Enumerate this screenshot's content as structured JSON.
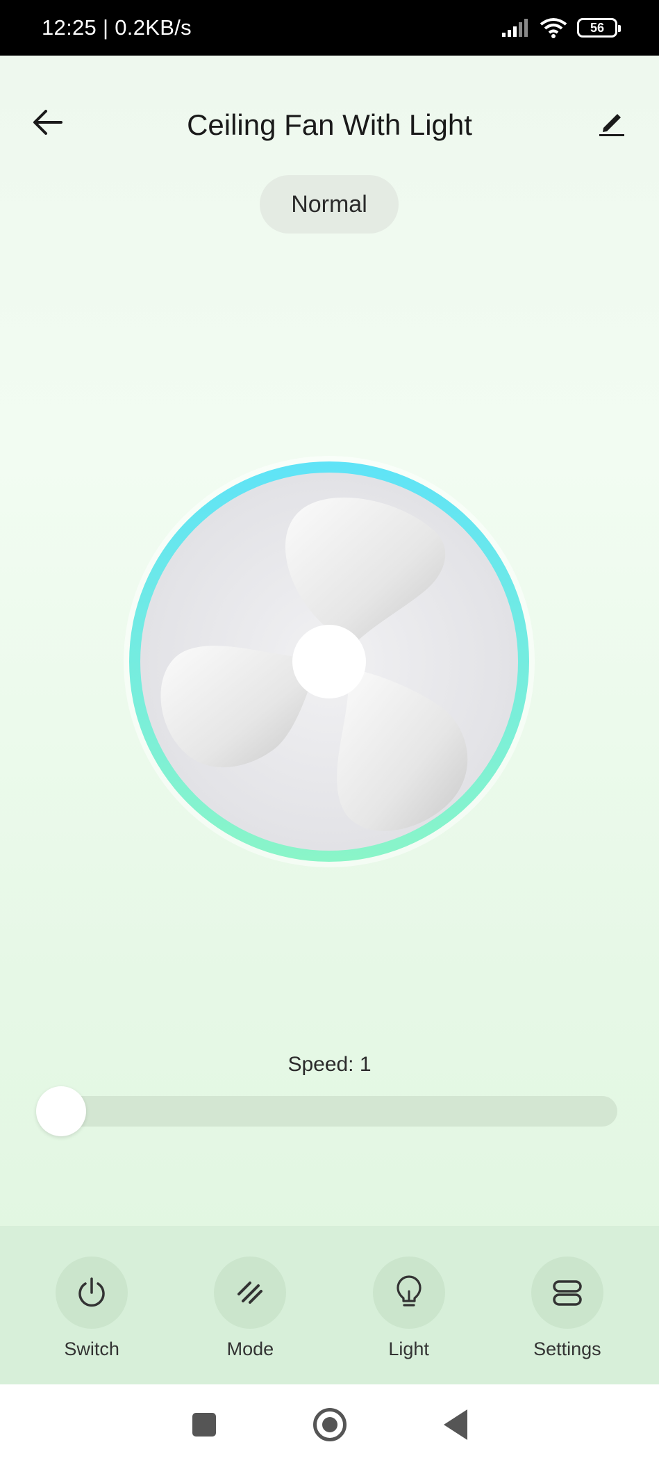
{
  "status_bar": {
    "time_speed": "12:25 | 0.2KB/s",
    "battery": "56"
  },
  "header": {
    "title": "Ceiling Fan With Light",
    "back_icon": "arrow-left-icon",
    "edit_icon": "pencil-icon"
  },
  "mode": {
    "label": "Normal"
  },
  "fan": {
    "ring_colors": [
      "#5fe3f7",
      "#8af5c8"
    ]
  },
  "speed": {
    "label": "Speed: 1",
    "level_fraction": 0.0
  },
  "tabs": [
    {
      "label": "Switch",
      "icon": "power-icon"
    },
    {
      "label": "Mode",
      "icon": "mode-slashes-icon"
    },
    {
      "label": "Light",
      "icon": "lightbulb-icon"
    },
    {
      "label": "Settings",
      "icon": "settings-icon"
    }
  ],
  "colors": {
    "tab_bar_bg": "#d7efd9",
    "accent_ring": "#5fe3f7"
  }
}
